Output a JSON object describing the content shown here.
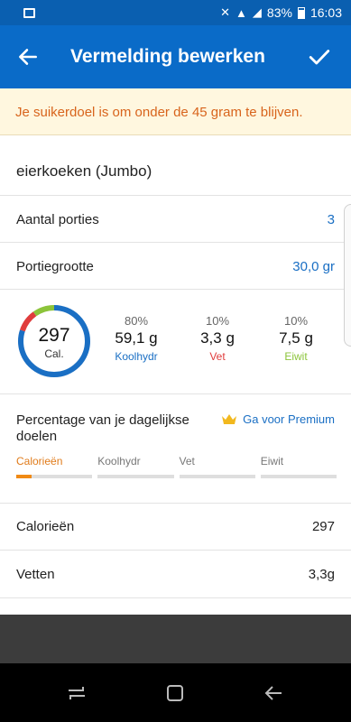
{
  "status_bar": {
    "battery": "83%",
    "time": "16:03"
  },
  "app_bar": {
    "title": "Vermelding bewerken"
  },
  "banner": {
    "text": "Je suikerdoel is om onder de 45 gram te blijven."
  },
  "entry": {
    "food_name": "eierkoeken (Jumbo)",
    "servings_label": "Aantal porties",
    "servings_value": "3",
    "serving_size_label": "Portiegrootte",
    "serving_size_value": "30,0 gr"
  },
  "summary": {
    "calories": "297",
    "calories_label": "Cal.",
    "macros": [
      {
        "pct": "80%",
        "amount": "59,1 g",
        "name": "Koolhydr",
        "color": "#1a6fc4"
      },
      {
        "pct": "10%",
        "amount": "3,3 g",
        "name": "Vet",
        "color": "#e03c3c"
      },
      {
        "pct": "10%",
        "amount": "7,5 g",
        "name": "Eiwit",
        "color": "#8cc43a"
      }
    ],
    "ring_fractions": {
      "carbs": 0.8,
      "fat": 0.1,
      "protein": 0.1
    }
  },
  "goals": {
    "heading": "Percentage van je dagelijkse doelen",
    "premium_label": "Ga voor Premium",
    "tabs": [
      {
        "label": "Calorieën",
        "fill": 0.2
      },
      {
        "label": "Koolhydr",
        "fill": 0
      },
      {
        "label": "Vet",
        "fill": 0
      },
      {
        "label": "Eiwit",
        "fill": 0
      }
    ]
  },
  "nutrients": [
    {
      "label": "Calorieën",
      "value": "297"
    },
    {
      "label": "Vetten",
      "value": "3,3g"
    }
  ],
  "icons": {
    "back": "arrow-left-icon",
    "save": "check-icon",
    "premium": "crown-icon"
  }
}
